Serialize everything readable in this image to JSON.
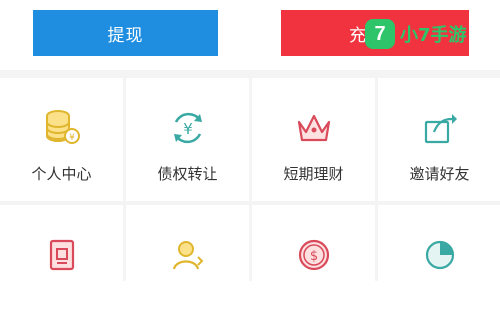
{
  "actions": {
    "withdraw_label": "提现",
    "recharge_label": "充"
  },
  "watermark": {
    "logo_char": "7",
    "text": "小7手游"
  },
  "menu": {
    "row1": [
      {
        "label": "个人中心",
        "icon": "coin-stack-icon"
      },
      {
        "label": "债权转让",
        "icon": "yen-exchange-icon"
      },
      {
        "label": "短期理财",
        "icon": "crown-icon"
      },
      {
        "label": "邀请好友",
        "icon": "share-icon"
      }
    ],
    "row2": [
      {
        "label": "",
        "icon": "document-icon"
      },
      {
        "label": "",
        "icon": "user-icon"
      },
      {
        "label": "",
        "icon": "dollar-coin-icon"
      },
      {
        "label": "",
        "icon": "pie-chart-icon"
      }
    ]
  },
  "colors": {
    "withdraw": "#1f8ee0",
    "recharge": "#f0333f",
    "watermark": "#2ec46a"
  }
}
